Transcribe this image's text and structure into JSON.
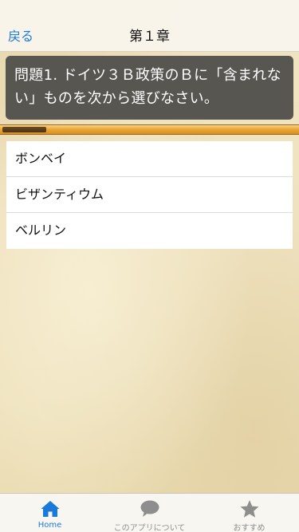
{
  "nav": {
    "back_label": "戻る",
    "title": "第１章"
  },
  "question": {
    "text": "問題1. ドイツ３Ｂ政策のＢに「含まれない」ものを次から選びなさい。"
  },
  "progress": {
    "fraction": 0.15
  },
  "choices": [
    {
      "label": "ボンベイ"
    },
    {
      "label": "ビザンティウム"
    },
    {
      "label": "ベルリン"
    }
  ],
  "tabbar": {
    "tabs": [
      {
        "label": "Home",
        "icon": "home-icon",
        "active": true
      },
      {
        "label": "このアプリについて",
        "icon": "speech-bubble-icon",
        "active": false
      },
      {
        "label": "おすすめ",
        "icon": "star-icon",
        "active": false
      }
    ]
  },
  "colors": {
    "accent": "#1a7ad9",
    "question_bg": "#575650",
    "progress_bar": "#e9a93a",
    "progress_fill": "#5a3d1c",
    "tab_inactive": "#8e8e8e"
  }
}
